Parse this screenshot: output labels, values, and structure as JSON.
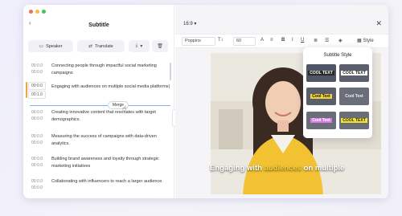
{
  "panel": {
    "title": "Subtitle",
    "buttons": {
      "speaker": "Speaker",
      "translate": "Translate"
    }
  },
  "rows": [
    {
      "start": "00:0.0",
      "end": "00:0.0",
      "text": "Connecting people through impactful social marketing campaigns"
    },
    {
      "start": "00:0.0",
      "end": "00:1.0",
      "text": "Engaging with audiences on multiple social media platforms|"
    },
    {
      "start": "00:0.0",
      "end": "00:0.0",
      "text": "Creating innovative content that resonates with target demographics."
    },
    {
      "start": "00:0.0",
      "end": "00:0.0",
      "text": "Measuring the success of campaigns with data-driven analytics."
    },
    {
      "start": "00:0.0",
      "end": "00:0.0",
      "text": "Building brand awareness and loyalty through strategic marketing initiatives"
    },
    {
      "start": "00:0.0",
      "end": "00:0.0",
      "text": "Collaborating with influencers to reach a larger audience."
    }
  ],
  "merge_label": "Merge",
  "editor": {
    "ratio": "16:9",
    "font": "Poppins",
    "size": "60",
    "style_label": "Style"
  },
  "caption": {
    "before": "Engaging with ",
    "highlight": "audiences",
    "after": " on multiple"
  },
  "popover": {
    "title": "Subtitle Style",
    "tiles": [
      {
        "label": "COOL TEXT",
        "bg": "#4f5564",
        "fg": "#ffffff",
        "chip": "#2a2a2a"
      },
      {
        "label": "COOL TEXT",
        "bg": "#5b5f6c",
        "fg": "#1a1a1a",
        "chip": "#ffffff"
      },
      {
        "label": "Cool Text",
        "bg": "#5b5f6c",
        "fg": "#111111",
        "chip": "#f0d23a"
      },
      {
        "label": "Cool Text",
        "bg": "#6a6e79",
        "fg": "#f3f3f3",
        "chip": ""
      },
      {
        "label": "Cool Text",
        "bg": "#6a6e79",
        "fg": "#ffffff",
        "chip": "#d77be8"
      },
      {
        "label": "COOL TEXT",
        "bg": "#6a6e79",
        "fg": "#2a2a2a",
        "chip": "#f2e230"
      }
    ]
  }
}
